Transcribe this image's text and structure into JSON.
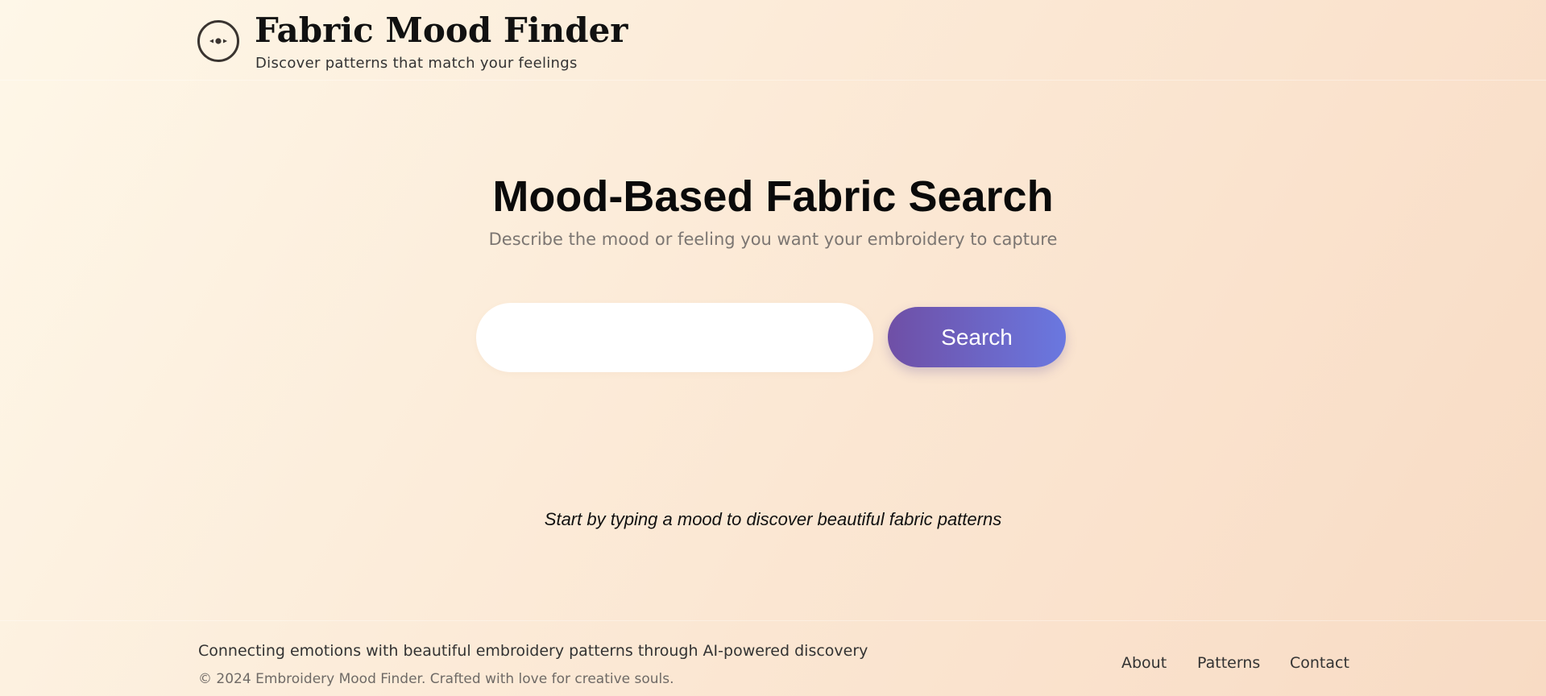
{
  "header": {
    "logo_icon": "eye-icon",
    "title": "Fabric Mood Finder",
    "tagline": "Discover patterns that match your feelings"
  },
  "hero": {
    "title": "Mood-Based Fabric Search",
    "subtitle": "Describe the mood or feeling you want your embroidery to capture"
  },
  "search": {
    "value": "",
    "placeholder": "",
    "button_label": "Search"
  },
  "results": {
    "empty_message": "Start by typing a mood to discover beautiful fabric patterns"
  },
  "footer": {
    "tagline": "Connecting emotions with beautiful embroidery patterns through AI-powered discovery",
    "copyright": "© 2024 Embroidery Mood Finder. Crafted with love for creative souls.",
    "nav": [
      {
        "label": "About"
      },
      {
        "label": "Patterns"
      },
      {
        "label": "Contact"
      }
    ]
  },
  "colors": {
    "button_gradient_start": "#6f4fa6",
    "button_gradient_end": "#6a78e0",
    "background_start": "#fef7e8",
    "background_end": "#f8dbc4"
  }
}
